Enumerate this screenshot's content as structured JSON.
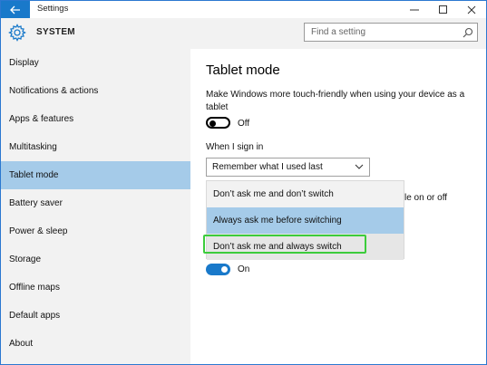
{
  "window": {
    "title": "Settings"
  },
  "header": {
    "app_title": "SYSTEM",
    "search_placeholder": "Find a setting",
    "icons": {
      "app": "gear-icon",
      "search": "search-icon",
      "back": "back-arrow-icon"
    }
  },
  "sidebar": {
    "items": [
      {
        "label": "Display"
      },
      {
        "label": "Notifications & actions"
      },
      {
        "label": "Apps & features"
      },
      {
        "label": "Multitasking"
      },
      {
        "label": "Tablet mode",
        "active": true
      },
      {
        "label": "Battery saver"
      },
      {
        "label": "Power & sleep"
      },
      {
        "label": "Storage"
      },
      {
        "label": "Offline maps"
      },
      {
        "label": "Default apps"
      },
      {
        "label": "About"
      }
    ]
  },
  "main": {
    "title": "Tablet mode",
    "description": "Make Windows more touch-friendly when using your device as a tablet",
    "toggle1_state": "Off",
    "signin_label": "When I sign in",
    "signin_selected": "Remember what I used last",
    "partial_text": "le on or off",
    "dropdown_options": [
      {
        "label": "Don’t ask me and don’t switch"
      },
      {
        "label": "Always ask me before switching",
        "hover": true
      },
      {
        "label": "Don’t ask me and always switch",
        "selected": true
      }
    ],
    "toggle2_state": "On"
  },
  "colors": {
    "accent": "#1979ca",
    "highlight": "#a5cbe9",
    "sidebar_bg": "#f2f2f2",
    "outline_green": "#3ccc3c"
  }
}
